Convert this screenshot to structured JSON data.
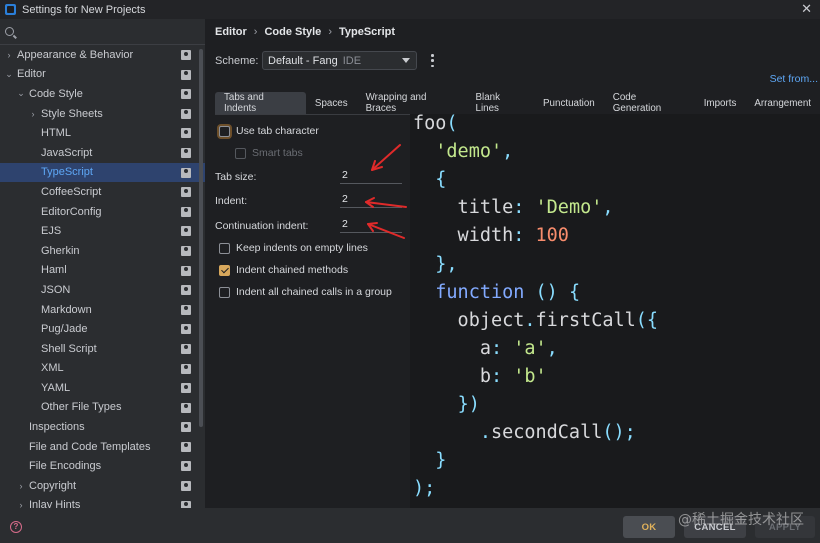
{
  "window": {
    "title": "Settings for New Projects",
    "close": "✕"
  },
  "search": {
    "placeholder": ""
  },
  "sidebar": {
    "items": [
      {
        "label": "Appearance & Behavior",
        "level": 0,
        "arrow": "›",
        "selected": false
      },
      {
        "label": "Editor",
        "level": 0,
        "arrow": "⌄",
        "selected": false
      },
      {
        "label": "Code Style",
        "level": 1,
        "arrow": "⌄",
        "selected": false
      },
      {
        "label": "Style Sheets",
        "level": 2,
        "arrow": "›",
        "selected": false
      },
      {
        "label": "HTML",
        "level": 2,
        "arrow": "",
        "selected": false
      },
      {
        "label": "JavaScript",
        "level": 2,
        "arrow": "",
        "selected": false
      },
      {
        "label": "TypeScript",
        "level": 2,
        "arrow": "",
        "selected": true
      },
      {
        "label": "CoffeeScript",
        "level": 2,
        "arrow": "",
        "selected": false
      },
      {
        "label": "EditorConfig",
        "level": 2,
        "arrow": "",
        "selected": false
      },
      {
        "label": "EJS",
        "level": 2,
        "arrow": "",
        "selected": false
      },
      {
        "label": "Gherkin",
        "level": 2,
        "arrow": "",
        "selected": false
      },
      {
        "label": "Haml",
        "level": 2,
        "arrow": "",
        "selected": false
      },
      {
        "label": "JSON",
        "level": 2,
        "arrow": "",
        "selected": false
      },
      {
        "label": "Markdown",
        "level": 2,
        "arrow": "",
        "selected": false
      },
      {
        "label": "Pug/Jade",
        "level": 2,
        "arrow": "",
        "selected": false
      },
      {
        "label": "Shell Script",
        "level": 2,
        "arrow": "",
        "selected": false
      },
      {
        "label": "XML",
        "level": 2,
        "arrow": "",
        "selected": false
      },
      {
        "label": "YAML",
        "level": 2,
        "arrow": "",
        "selected": false
      },
      {
        "label": "Other File Types",
        "level": 2,
        "arrow": "",
        "selected": false
      },
      {
        "label": "Inspections",
        "level": 1,
        "arrow": "",
        "selected": false
      },
      {
        "label": "File and Code Templates",
        "level": 1,
        "arrow": "",
        "selected": false
      },
      {
        "label": "File Encodings",
        "level": 1,
        "arrow": "",
        "selected": false
      },
      {
        "label": "Copyright",
        "level": 1,
        "arrow": "›",
        "selected": false
      },
      {
        "label": "Inlay Hints",
        "level": 1,
        "arrow": "›",
        "selected": false
      }
    ]
  },
  "breadcrumb": [
    "Editor",
    "Code Style",
    "TypeScript"
  ],
  "breadcrumb_sep": "›",
  "scheme": {
    "label": "Scheme:",
    "value": "Default - Fang",
    "tag": "IDE"
  },
  "set_from": "Set from...",
  "tabs": [
    "Tabs and Indents",
    "Spaces",
    "Wrapping and Braces",
    "Blank Lines",
    "Punctuation",
    "Code Generation",
    "Imports",
    "Arrangement"
  ],
  "active_tab": 0,
  "options": {
    "use_tab_character": {
      "label": "Use tab character",
      "checked": false
    },
    "smart_tabs": {
      "label": "Smart tabs",
      "checked": false,
      "disabled": true
    },
    "tab_size": {
      "label": "Tab size:",
      "value": "2"
    },
    "indent": {
      "label": "Indent:",
      "value": "2"
    },
    "continuation_indent": {
      "label": "Continuation indent:",
      "value": "2"
    },
    "keep_indents": {
      "label": "Keep indents on empty lines",
      "checked": false
    },
    "indent_chained": {
      "label": "Indent chained methods",
      "checked": true
    },
    "indent_all_chained": {
      "label": "Indent all chained calls in a group",
      "checked": false
    }
  },
  "code_preview": [
    [
      {
        "t": "foo",
        "c": "id"
      },
      {
        "t": "(",
        "c": "punc"
      }
    ],
    [
      {
        "t": "  ",
        "c": "id"
      },
      {
        "t": "'demo'",
        "c": "str"
      },
      {
        "t": ",",
        "c": "punc"
      }
    ],
    [
      {
        "t": "  ",
        "c": "id"
      },
      {
        "t": "{",
        "c": "punc"
      }
    ],
    [
      {
        "t": "    title",
        "c": "id"
      },
      {
        "t": ": ",
        "c": "punc"
      },
      {
        "t": "'Demo'",
        "c": "str"
      },
      {
        "t": ",",
        "c": "punc"
      }
    ],
    [
      {
        "t": "    width",
        "c": "id"
      },
      {
        "t": ": ",
        "c": "punc"
      },
      {
        "t": "100",
        "c": "num"
      }
    ],
    [
      {
        "t": "  ",
        "c": "id"
      },
      {
        "t": "},",
        "c": "punc"
      }
    ],
    [
      {
        "t": "  ",
        "c": "id"
      },
      {
        "t": "function",
        "c": "kw"
      },
      {
        "t": " () {",
        "c": "punc"
      }
    ],
    [
      {
        "t": "    object",
        "c": "id"
      },
      {
        "t": ".",
        "c": "punc"
      },
      {
        "t": "firstCall",
        "c": "id"
      },
      {
        "t": "({",
        "c": "punc"
      }
    ],
    [
      {
        "t": "      a",
        "c": "id"
      },
      {
        "t": ": ",
        "c": "punc"
      },
      {
        "t": "'a'",
        "c": "str"
      },
      {
        "t": ",",
        "c": "punc"
      }
    ],
    [
      {
        "t": "      b",
        "c": "id"
      },
      {
        "t": ": ",
        "c": "punc"
      },
      {
        "t": "'b'",
        "c": "str"
      }
    ],
    [
      {
        "t": "    ",
        "c": "id"
      },
      {
        "t": "})",
        "c": "punc"
      }
    ],
    [
      {
        "t": "      ",
        "c": "id"
      },
      {
        "t": ".",
        "c": "punc"
      },
      {
        "t": "secondCall",
        "c": "id"
      },
      {
        "t": "();",
        "c": "punc"
      }
    ],
    [
      {
        "t": "  ",
        "c": "id"
      },
      {
        "t": "}",
        "c": "punc"
      }
    ],
    [
      {
        "t": ");",
        "c": "punc"
      }
    ]
  ],
  "buttons": {
    "ok": "OK",
    "cancel": "CANCEL",
    "apply": "APPLY",
    "help": "?"
  },
  "watermark": "@稀土掘金技术社区",
  "colors": {
    "accent": "#5ea7f5",
    "selection": "#2e436e",
    "checkbox_checked": "#d8a85c",
    "annotation_arrow": "#e02a2a"
  }
}
